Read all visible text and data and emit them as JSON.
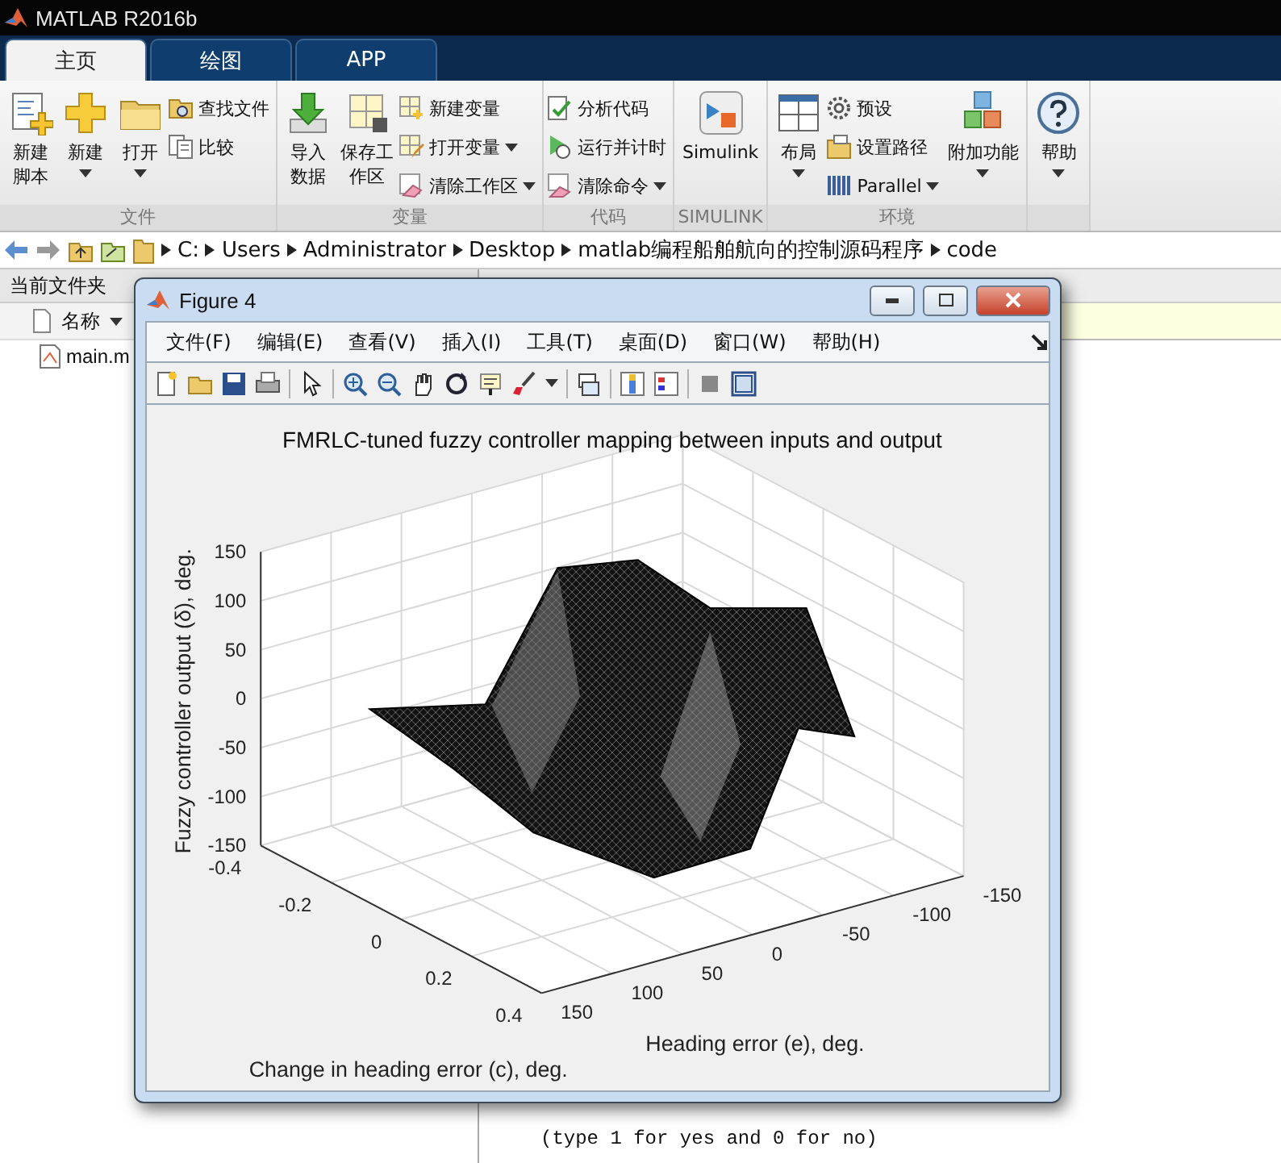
{
  "app_title": "MATLAB R2016b",
  "tabs": [
    {
      "label": "主页",
      "selected": true
    },
    {
      "label": "绘图",
      "selected": false
    },
    {
      "label": "APP",
      "selected": false
    }
  ],
  "ribbon": [
    {
      "label": "文件",
      "items": [
        {
          "kind": "large",
          "label": "新建脚本",
          "dropdown": false
        },
        {
          "kind": "large",
          "label": "新建",
          "dropdown": true
        },
        {
          "kind": "large",
          "label": "打开",
          "dropdown": true
        },
        {
          "kind": "stack",
          "items": [
            {
              "label": "查找文件",
              "dropdown": false
            },
            {
              "label": "比较",
              "dropdown": false
            }
          ]
        }
      ]
    },
    {
      "label": "变量",
      "items": [
        {
          "kind": "large",
          "label": "导入数据",
          "dropdown": false
        },
        {
          "kind": "large",
          "label": "保存工作区",
          "dropdown": false
        },
        {
          "kind": "stack",
          "items": [
            {
              "label": "新建变量",
              "dropdown": false
            },
            {
              "label": "打开变量",
              "dropdown": true
            },
            {
              "label": "清除工作区",
              "dropdown": true
            }
          ]
        }
      ]
    },
    {
      "label": "代码",
      "items": [
        {
          "kind": "stack",
          "items": [
            {
              "label": "分析代码",
              "dropdown": false
            },
            {
              "label": "运行并计时",
              "dropdown": false
            },
            {
              "label": "清除命令",
              "dropdown": true
            }
          ]
        }
      ]
    },
    {
      "label": "SIMULINK",
      "items": [
        {
          "kind": "large",
          "label": "Simulink",
          "dropdown": false
        }
      ]
    },
    {
      "label": "环境",
      "items": [
        {
          "kind": "large",
          "label": "布局",
          "dropdown": true
        },
        {
          "kind": "stack",
          "items": [
            {
              "label": "预设",
              "dropdown": false
            },
            {
              "label": "设置路径",
              "dropdown": false
            },
            {
              "label": "Parallel",
              "dropdown": true
            }
          ]
        },
        {
          "kind": "large",
          "label": "附加功能",
          "dropdown": true
        }
      ]
    },
    {
      "items": [
        {
          "kind": "large",
          "label": "帮助",
          "dropdown": true
        }
      ]
    }
  ],
  "path": [
    "C:",
    "Users",
    "Administrator",
    "Desktop",
    "matlab编程船舶航向的控制源码程序",
    "code"
  ],
  "file_panel": {
    "title": "当前文件夹",
    "column": "名称",
    "files": [
      "main.m"
    ]
  },
  "console": [
    "(type 1 for yes and 0 for no)"
  ],
  "figure": {
    "title": "Figure 4",
    "menu": [
      "文件(F)",
      "编辑(E)",
      "查看(V)",
      "插入(I)",
      "工具(T)",
      "桌面(D)",
      "窗口(W)",
      "帮助(H)"
    ],
    "plot": {
      "title": "FMRLC-tuned fuzzy controller mapping between inputs and output",
      "zlabel": "Fuzzy controller output (δ), deg.",
      "xlabel": "Heading error (e), deg.",
      "ylabel": "Change in heading error (c), deg.",
      "z_ticks": [
        "150",
        "100",
        "50",
        "0",
        "-50",
        "-100",
        "-150"
      ],
      "c_ticks": [
        "-0.4",
        "-0.2",
        "0",
        "0.2",
        "0.4"
      ],
      "e_ticks": [
        "150",
        "100",
        "50",
        "0",
        "-50",
        "-100",
        "-150"
      ]
    }
  }
}
